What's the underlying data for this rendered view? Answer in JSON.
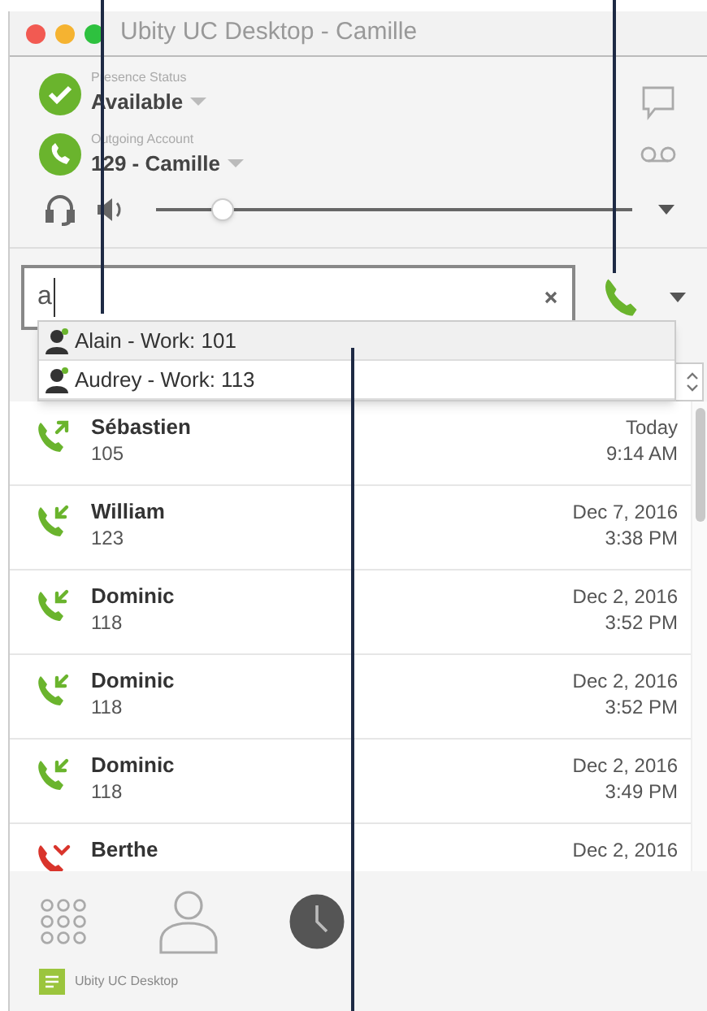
{
  "window": {
    "title": "Ubity UC Desktop - Camille"
  },
  "presence": {
    "label": "Presence Status",
    "value": "Available"
  },
  "account": {
    "label": "Outgoing Account",
    "value": "129 - Camille"
  },
  "volume": {
    "level": 0.14
  },
  "search": {
    "value": "a"
  },
  "suggestions": [
    {
      "text": "Alain - Work: 101",
      "selected": true
    },
    {
      "text": "Audrey - Work: 113",
      "selected": false
    }
  ],
  "calls": [
    {
      "kind": "outgoing",
      "name": "Sébastien",
      "number": "105",
      "date": "Today",
      "time": "9:14 AM"
    },
    {
      "kind": "incoming",
      "name": "William",
      "number": "123",
      "date": "Dec 7, 2016",
      "time": "3:38 PM"
    },
    {
      "kind": "incoming",
      "name": "Dominic",
      "number": "118",
      "date": "Dec 2, 2016",
      "time": "3:52 PM"
    },
    {
      "kind": "incoming",
      "name": "Dominic",
      "number": "118",
      "date": "Dec 2, 2016",
      "time": "3:52 PM"
    },
    {
      "kind": "incoming",
      "name": "Dominic",
      "number": "118",
      "date": "Dec 2, 2016",
      "time": "3:49 PM"
    },
    {
      "kind": "missed",
      "name": "Berthe",
      "date": "Dec 2, 2016"
    }
  ],
  "tabs": [
    {
      "kind": "dialpad",
      "selected": false
    },
    {
      "kind": "contacts",
      "selected": false
    },
    {
      "kind": "history",
      "selected": true
    }
  ],
  "footer": {
    "app_name": "Ubity UC Desktop"
  }
}
